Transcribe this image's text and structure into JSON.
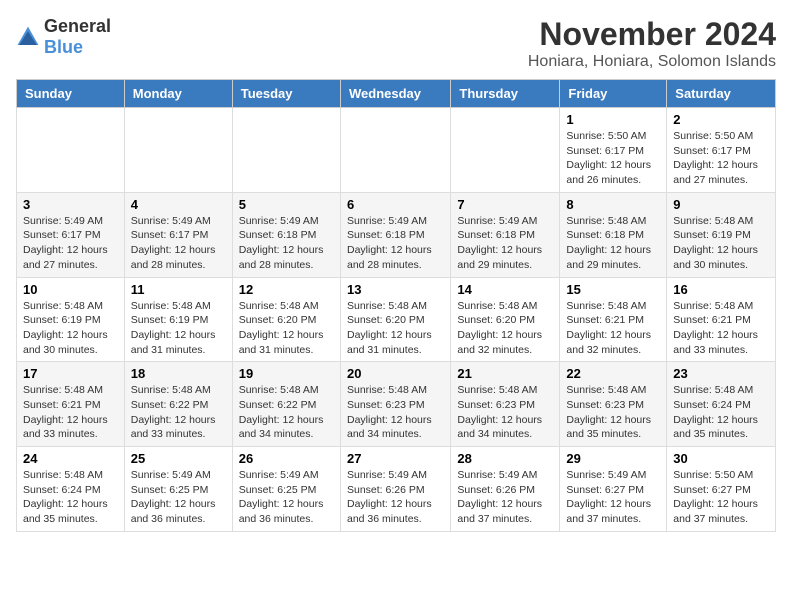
{
  "header": {
    "logo_general": "General",
    "logo_blue": "Blue",
    "month_title": "November 2024",
    "location": "Honiara, Honiara, Solomon Islands"
  },
  "days_of_week": [
    "Sunday",
    "Monday",
    "Tuesday",
    "Wednesday",
    "Thursday",
    "Friday",
    "Saturday"
  ],
  "weeks": [
    [
      {
        "day": "",
        "info": ""
      },
      {
        "day": "",
        "info": ""
      },
      {
        "day": "",
        "info": ""
      },
      {
        "day": "",
        "info": ""
      },
      {
        "day": "",
        "info": ""
      },
      {
        "day": "1",
        "info": "Sunrise: 5:50 AM\nSunset: 6:17 PM\nDaylight: 12 hours and 26 minutes."
      },
      {
        "day": "2",
        "info": "Sunrise: 5:50 AM\nSunset: 6:17 PM\nDaylight: 12 hours and 27 minutes."
      }
    ],
    [
      {
        "day": "3",
        "info": "Sunrise: 5:49 AM\nSunset: 6:17 PM\nDaylight: 12 hours and 27 minutes."
      },
      {
        "day": "4",
        "info": "Sunrise: 5:49 AM\nSunset: 6:17 PM\nDaylight: 12 hours and 28 minutes."
      },
      {
        "day": "5",
        "info": "Sunrise: 5:49 AM\nSunset: 6:18 PM\nDaylight: 12 hours and 28 minutes."
      },
      {
        "day": "6",
        "info": "Sunrise: 5:49 AM\nSunset: 6:18 PM\nDaylight: 12 hours and 28 minutes."
      },
      {
        "day": "7",
        "info": "Sunrise: 5:49 AM\nSunset: 6:18 PM\nDaylight: 12 hours and 29 minutes."
      },
      {
        "day": "8",
        "info": "Sunrise: 5:48 AM\nSunset: 6:18 PM\nDaylight: 12 hours and 29 minutes."
      },
      {
        "day": "9",
        "info": "Sunrise: 5:48 AM\nSunset: 6:19 PM\nDaylight: 12 hours and 30 minutes."
      }
    ],
    [
      {
        "day": "10",
        "info": "Sunrise: 5:48 AM\nSunset: 6:19 PM\nDaylight: 12 hours and 30 minutes."
      },
      {
        "day": "11",
        "info": "Sunrise: 5:48 AM\nSunset: 6:19 PM\nDaylight: 12 hours and 31 minutes."
      },
      {
        "day": "12",
        "info": "Sunrise: 5:48 AM\nSunset: 6:20 PM\nDaylight: 12 hours and 31 minutes."
      },
      {
        "day": "13",
        "info": "Sunrise: 5:48 AM\nSunset: 6:20 PM\nDaylight: 12 hours and 31 minutes."
      },
      {
        "day": "14",
        "info": "Sunrise: 5:48 AM\nSunset: 6:20 PM\nDaylight: 12 hours and 32 minutes."
      },
      {
        "day": "15",
        "info": "Sunrise: 5:48 AM\nSunset: 6:21 PM\nDaylight: 12 hours and 32 minutes."
      },
      {
        "day": "16",
        "info": "Sunrise: 5:48 AM\nSunset: 6:21 PM\nDaylight: 12 hours and 33 minutes."
      }
    ],
    [
      {
        "day": "17",
        "info": "Sunrise: 5:48 AM\nSunset: 6:21 PM\nDaylight: 12 hours and 33 minutes."
      },
      {
        "day": "18",
        "info": "Sunrise: 5:48 AM\nSunset: 6:22 PM\nDaylight: 12 hours and 33 minutes."
      },
      {
        "day": "19",
        "info": "Sunrise: 5:48 AM\nSunset: 6:22 PM\nDaylight: 12 hours and 34 minutes."
      },
      {
        "day": "20",
        "info": "Sunrise: 5:48 AM\nSunset: 6:23 PM\nDaylight: 12 hours and 34 minutes."
      },
      {
        "day": "21",
        "info": "Sunrise: 5:48 AM\nSunset: 6:23 PM\nDaylight: 12 hours and 34 minutes."
      },
      {
        "day": "22",
        "info": "Sunrise: 5:48 AM\nSunset: 6:23 PM\nDaylight: 12 hours and 35 minutes."
      },
      {
        "day": "23",
        "info": "Sunrise: 5:48 AM\nSunset: 6:24 PM\nDaylight: 12 hours and 35 minutes."
      }
    ],
    [
      {
        "day": "24",
        "info": "Sunrise: 5:48 AM\nSunset: 6:24 PM\nDaylight: 12 hours and 35 minutes."
      },
      {
        "day": "25",
        "info": "Sunrise: 5:49 AM\nSunset: 6:25 PM\nDaylight: 12 hours and 36 minutes."
      },
      {
        "day": "26",
        "info": "Sunrise: 5:49 AM\nSunset: 6:25 PM\nDaylight: 12 hours and 36 minutes."
      },
      {
        "day": "27",
        "info": "Sunrise: 5:49 AM\nSunset: 6:26 PM\nDaylight: 12 hours and 36 minutes."
      },
      {
        "day": "28",
        "info": "Sunrise: 5:49 AM\nSunset: 6:26 PM\nDaylight: 12 hours and 37 minutes."
      },
      {
        "day": "29",
        "info": "Sunrise: 5:49 AM\nSunset: 6:27 PM\nDaylight: 12 hours and 37 minutes."
      },
      {
        "day": "30",
        "info": "Sunrise: 5:50 AM\nSunset: 6:27 PM\nDaylight: 12 hours and 37 minutes."
      }
    ]
  ]
}
